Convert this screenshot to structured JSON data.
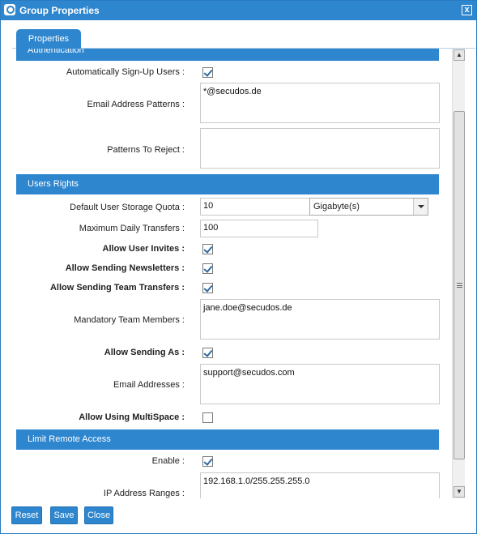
{
  "window": {
    "title": "Group Properties",
    "close": "x"
  },
  "tabs": [
    {
      "label": "Properties"
    }
  ],
  "sections": {
    "authentication": "Authentication",
    "users_rights": "Users Rights",
    "limit_remote_access": "Limit Remote Access"
  },
  "fields": {
    "auto_signup": {
      "label": "Automatically Sign-Up Users :",
      "checked": true
    },
    "email_patterns": {
      "label": "Email Address Patterns :",
      "value": "*@secudos.de"
    },
    "patterns_reject": {
      "label": "Patterns To Reject :",
      "value": ""
    },
    "storage_quota": {
      "label": "Default User Storage Quota :",
      "value": "10",
      "unit": "Gigabyte(s)"
    },
    "max_daily": {
      "label": "Maximum Daily Transfers :",
      "value": "100"
    },
    "allow_invites": {
      "label": "Allow User Invites :",
      "checked": true
    },
    "allow_newsletters": {
      "label": "Allow Sending Newsletters :",
      "checked": true
    },
    "allow_team": {
      "label": "Allow Sending Team Transfers :",
      "checked": true
    },
    "mandatory_members": {
      "label": "Mandatory Team Members :",
      "value": "jane.doe@secudos.de"
    },
    "allow_sending_as": {
      "label": "Allow Sending As :",
      "checked": true
    },
    "email_addresses": {
      "label": "Email Addresses :",
      "value": "support@secudos.com"
    },
    "allow_multispace": {
      "label": "Allow Using MultiSpace :",
      "checked": false
    },
    "enable": {
      "label": "Enable :",
      "checked": true
    },
    "ip_ranges": {
      "label": "IP Address Ranges :",
      "value": "192.168.1.0/255.255.255.0"
    }
  },
  "buttons": {
    "reset": "Reset",
    "save": "Save",
    "close": "Close"
  }
}
